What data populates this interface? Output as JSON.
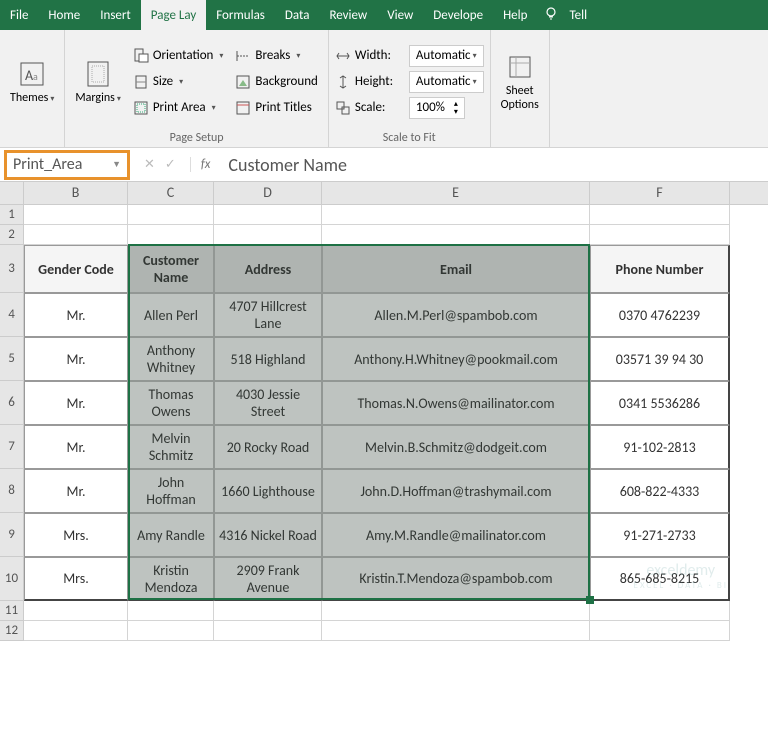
{
  "tabs": [
    "File",
    "Home",
    "Insert",
    "Page Lay",
    "Formulas",
    "Data",
    "Review",
    "View",
    "Develope",
    "Help",
    "Tell"
  ],
  "active_tab_index": 3,
  "ribbon": {
    "themes": {
      "label": "Themes"
    },
    "margins": {
      "label": "Margins"
    },
    "page_setup": {
      "orientation": "Orientation",
      "size": "Size",
      "print_area": "Print Area",
      "breaks": "Breaks",
      "background": "Background",
      "print_titles": "Print Titles",
      "group_label": "Page Setup"
    },
    "scale": {
      "width_label": "Width:",
      "width_value": "Automatic",
      "height_label": "Height:",
      "height_value": "Automatic",
      "scale_label": "Scale:",
      "scale_value": "100%",
      "group_label": "Scale to Fit"
    },
    "sheet_options": {
      "label": "Sheet\nOptions"
    }
  },
  "name_box": "Print_Area",
  "formula_value": "Customer Name",
  "columns": [
    "B",
    "C",
    "D",
    "E",
    "F"
  ],
  "row_numbers": [
    1,
    2,
    3,
    4,
    5,
    6,
    7,
    8,
    9,
    10,
    11,
    12
  ],
  "headers": {
    "b": "Gender Code",
    "c": "Customer Name",
    "d": "Address",
    "e": "Email",
    "f": "Phone Number"
  },
  "data": [
    {
      "gender": "Mr.",
      "name": "Allen Perl",
      "address": "4707 Hillcrest Lane",
      "email": "Allen.M.Perl@spambob.com",
      "phone": "0370 4762239"
    },
    {
      "gender": "Mr.",
      "name": "Anthony Whitney",
      "address": "518 Highland",
      "email": "Anthony.H.Whitney@pookmail.com",
      "phone": "03571 39 94 30"
    },
    {
      "gender": "Mr.",
      "name": "Thomas Owens",
      "address": "4030 Jessie Street",
      "email": "Thomas.N.Owens@mailinator.com",
      "phone": "0341 5536286"
    },
    {
      "gender": "Mr.",
      "name": "Melvin Schmitz",
      "address": "20 Rocky Road",
      "email": "Melvin.B.Schmitz@dodgeit.com",
      "phone": "91-102-2813"
    },
    {
      "gender": "Mr.",
      "name": "John Hoffman",
      "address": "1660 Lighthouse",
      "email": "John.D.Hoffman@trashymail.com",
      "phone": "608-822-4333"
    },
    {
      "gender": "Mrs.",
      "name": "Amy Randle",
      "address": "4316 Nickel Road",
      "email": "Amy.M.Randle@mailinator.com",
      "phone": "91-271-2733"
    },
    {
      "gender": "Mrs.",
      "name": "Kristin Mendoza",
      "address": "2909 Frank Avenue",
      "email": "Kristin.T.Mendoza@spambob.com",
      "phone": "865-685-8215"
    }
  ],
  "watermark": {
    "main": "exceldemy",
    "sub": "EXCEL · DATA · BI"
  }
}
